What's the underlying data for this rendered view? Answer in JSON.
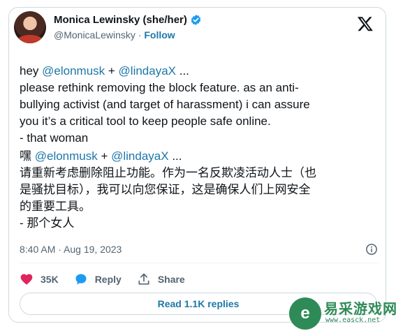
{
  "author": {
    "name": "Monica Lewinsky (she/her)",
    "handle": "@MonicaLewinsky",
    "separator": "·",
    "follow_label": "Follow"
  },
  "tweet": {
    "en": {
      "greeting": "hey ",
      "mention1": "@elonmusk",
      "plus": " + ",
      "mention2": "@lindayaX",
      "ellipsis": " ...",
      "line2": "please rethink removing the block feature. as an anti-",
      "line3": "bullying activist (and target of harassment) i can assure",
      "line4": "you it’s a critical tool to keep people safe online.",
      "line5": "- that woman"
    },
    "zh": {
      "greeting": "嘿 ",
      "mention1": "@elonmusk",
      "plus": " + ",
      "mention2": "@lindayaX",
      "ellipsis": " ...",
      "line2": "请重新考虑删除阻止功能。作为一名反欺凌活动人士（也",
      "line3": "是骚扰目标），我可以向您保证，这是确保人们上网安全",
      "line4": "的重要工具。",
      "line5": "- 那个女人"
    }
  },
  "meta": {
    "time": "8:40 AM",
    "date_sep": " · ",
    "date": "Aug 19, 2023"
  },
  "actions": {
    "likes": "35K",
    "reply": "Reply",
    "share": "Share"
  },
  "replies_label": "Read 1.1K replies",
  "watermark": {
    "badge": "e",
    "name": "易采游戏网",
    "url": "www.easck.net"
  },
  "colors": {
    "link": "#1d77a8",
    "secondary": "#536471",
    "like": "#e0245e",
    "verified": "#1d9bf0"
  }
}
